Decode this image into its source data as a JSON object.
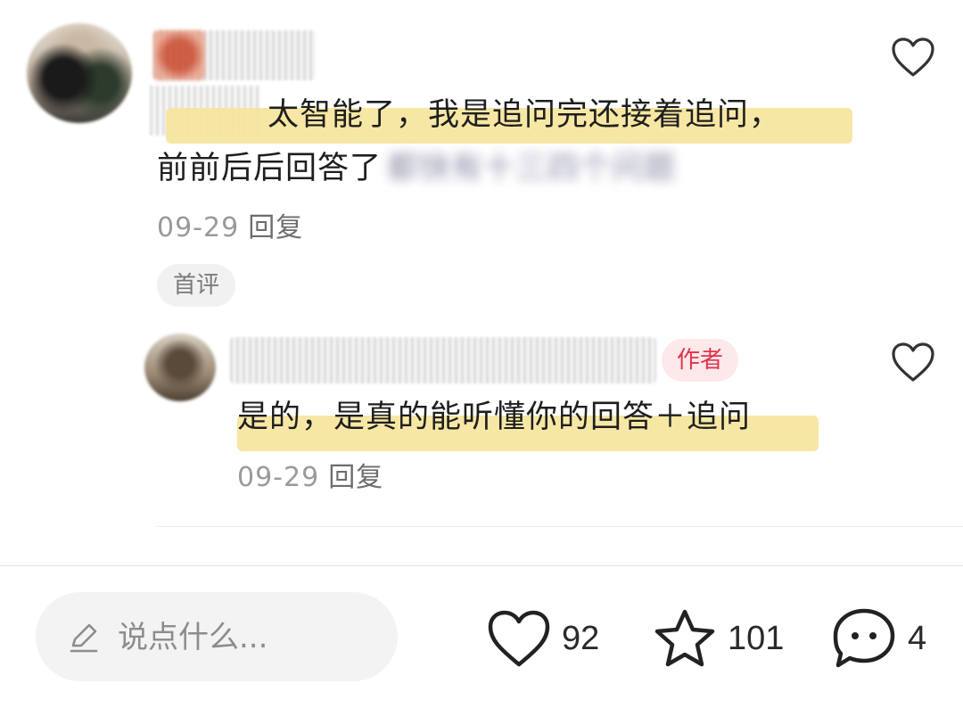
{
  "main_comment": {
    "text_line1": "太智能了，我是追问完还接着追问，",
    "text_line2": "前前后后回答了",
    "text_blurred": "都快有十三四个问题",
    "date": "09-29",
    "reply_label": "回复",
    "first_tag": "首评"
  },
  "reply_comment": {
    "author_tag": "作者",
    "text": "是的，是真的能听懂你的回答＋追问",
    "date": "09-29",
    "reply_label": "回复"
  },
  "bottom_bar": {
    "input_placeholder": "说点什么...",
    "like_count": "92",
    "favorite_count": "101",
    "comment_count": "4"
  },
  "colors": {
    "highlight": "#f6e49a",
    "author_tag_text": "#e0344a",
    "author_tag_bg": "#fde8ea"
  },
  "icons": [
    "heart-outline-icon",
    "star-outline-icon",
    "chat-bubble-icon",
    "pencil-icon"
  ]
}
